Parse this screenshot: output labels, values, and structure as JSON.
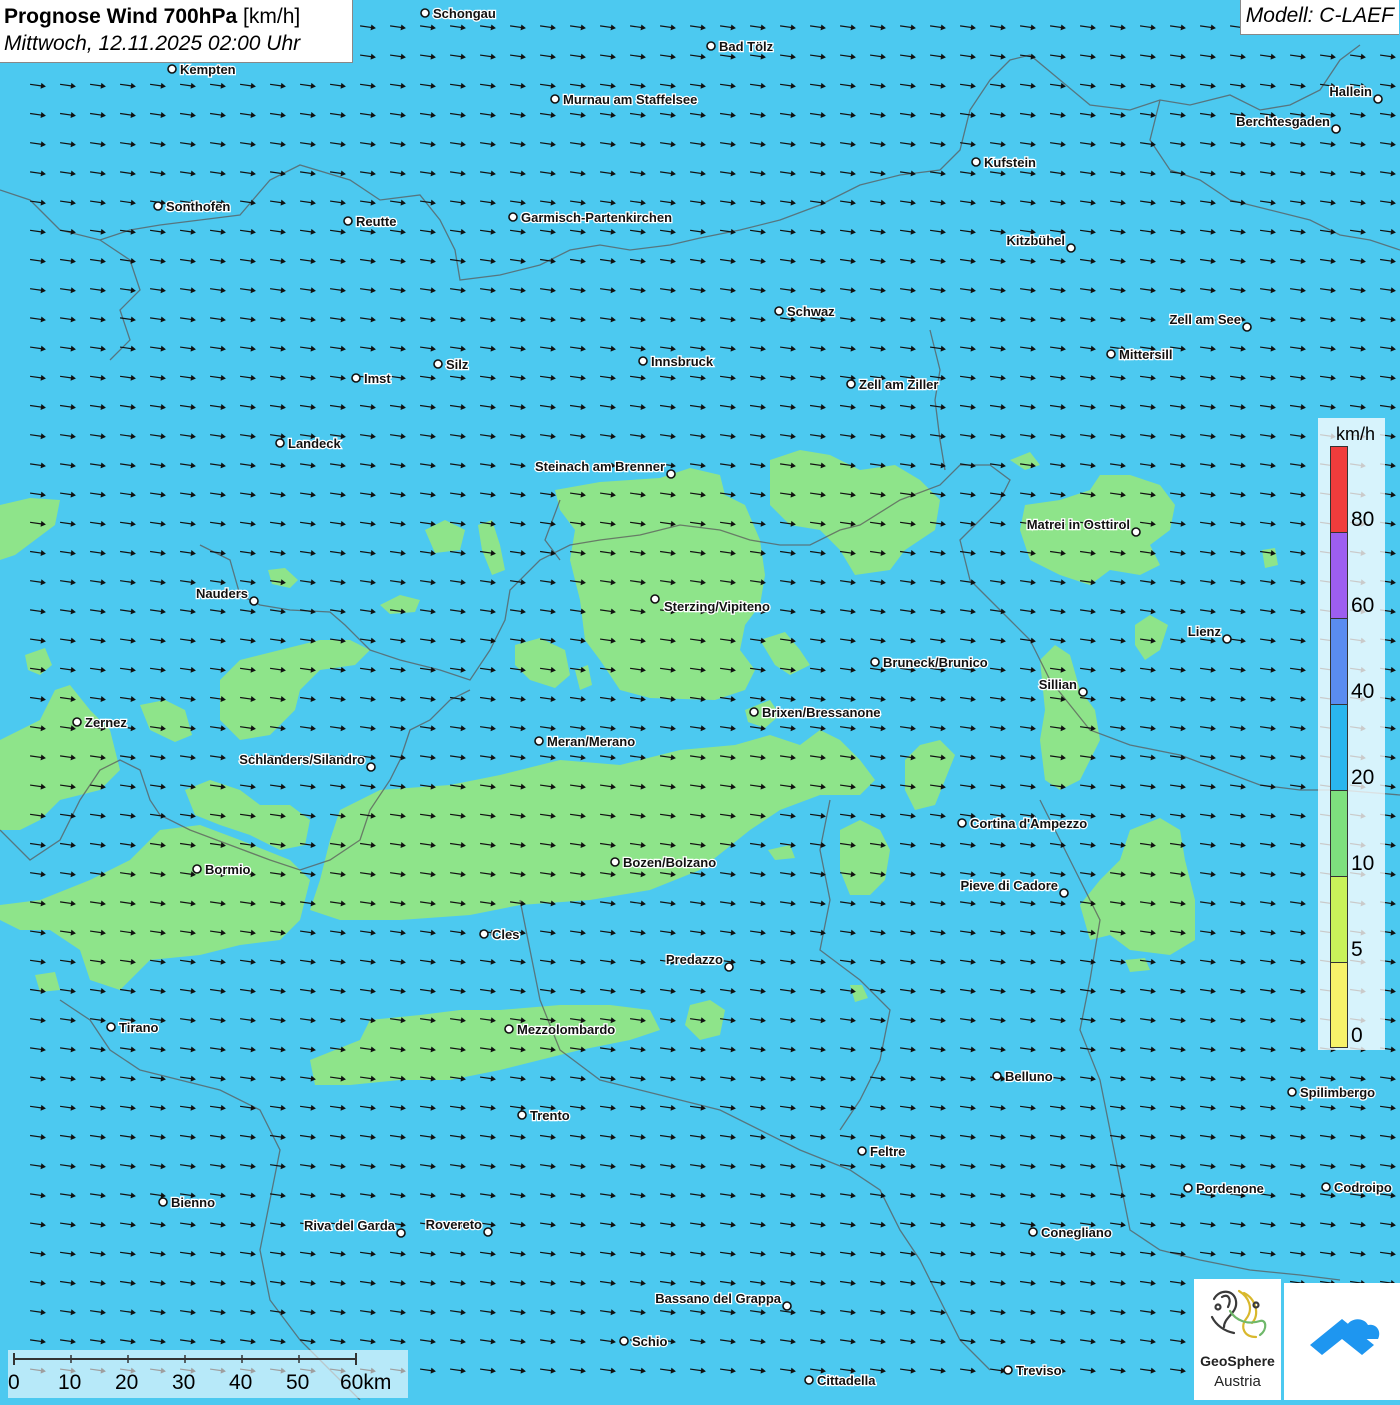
{
  "title": {
    "prefix": "Prognose Wind 700hPa",
    "unit": "[km/h]",
    "datetime": "Mittwoch, 12.11.2025 02:00 Uhr"
  },
  "model": "Modell: C-LAEF",
  "legend": {
    "unit": "km/h",
    "labels": [
      "80",
      "60",
      "40",
      "20",
      "10",
      "5",
      "0"
    ],
    "colors": [
      "#f03c3c",
      "#9d5ef0",
      "#5a8cf0",
      "#2ab6ee",
      "#7ee07e",
      "#c9f25a",
      "#f7f26a"
    ]
  },
  "scale": {
    "labels": [
      "0",
      "10",
      "20",
      "30",
      "40",
      "50",
      "60km"
    ]
  },
  "colors": {
    "wind_10_20": "#43c6f2",
    "wind_5_10": "#8ee48a",
    "borders": "#5a5a5a",
    "arrows": "#111111"
  },
  "wind_direction": "east",
  "cities": [
    {
      "name": "Schongau"
    },
    {
      "name": "Bad Tölz"
    },
    {
      "name": "Kempten"
    },
    {
      "name": "Murnau am Staffelsee"
    },
    {
      "name": "Hallein"
    },
    {
      "name": "Berchtesgaden"
    },
    {
      "name": "Kufstein"
    },
    {
      "name": "Sonthofen"
    },
    {
      "name": "Reutte"
    },
    {
      "name": "Garmisch-Partenkirchen"
    },
    {
      "name": "Kitzbühel"
    },
    {
      "name": "Schwaz"
    },
    {
      "name": "Zell am See"
    },
    {
      "name": "Mittersill"
    },
    {
      "name": "Innsbruck"
    },
    {
      "name": "Silz"
    },
    {
      "name": "Imst"
    },
    {
      "name": "Zell am Ziller"
    },
    {
      "name": "Landeck"
    },
    {
      "name": "Steinach am Brenner"
    },
    {
      "name": "Matrei in Osttirol"
    },
    {
      "name": "Nauders"
    },
    {
      "name": "Sterzing/Vipiteno"
    },
    {
      "name": "Lienz"
    },
    {
      "name": "Bruneck/Brunico"
    },
    {
      "name": "Sillian"
    },
    {
      "name": "Zernez"
    },
    {
      "name": "Brixen/Bressanone"
    },
    {
      "name": "Meran/Merano"
    },
    {
      "name": "Schlanders/Silandro"
    },
    {
      "name": "Cortina d'Ampezzo"
    },
    {
      "name": "Bozen/Bolzano"
    },
    {
      "name": "Bormio"
    },
    {
      "name": "Pieve di Cadore"
    },
    {
      "name": "Cles"
    },
    {
      "name": "Predazzo"
    },
    {
      "name": "Tirano"
    },
    {
      "name": "Mezzolombardo"
    },
    {
      "name": "Belluno"
    },
    {
      "name": "Spilimbergo"
    },
    {
      "name": "Trento"
    },
    {
      "name": "Feltre"
    },
    {
      "name": "Pordenone"
    },
    {
      "name": "Codroipo"
    },
    {
      "name": "Bienno"
    },
    {
      "name": "Riva del Garda"
    },
    {
      "name": "Rovereto"
    },
    {
      "name": "Conegliano"
    },
    {
      "name": "Bassano del Grappa"
    },
    {
      "name": "Schio"
    },
    {
      "name": "Treviso"
    },
    {
      "name": "Cittadella"
    }
  ],
  "logo": {
    "name": "GeoSphere",
    "sub": "Austria"
  }
}
